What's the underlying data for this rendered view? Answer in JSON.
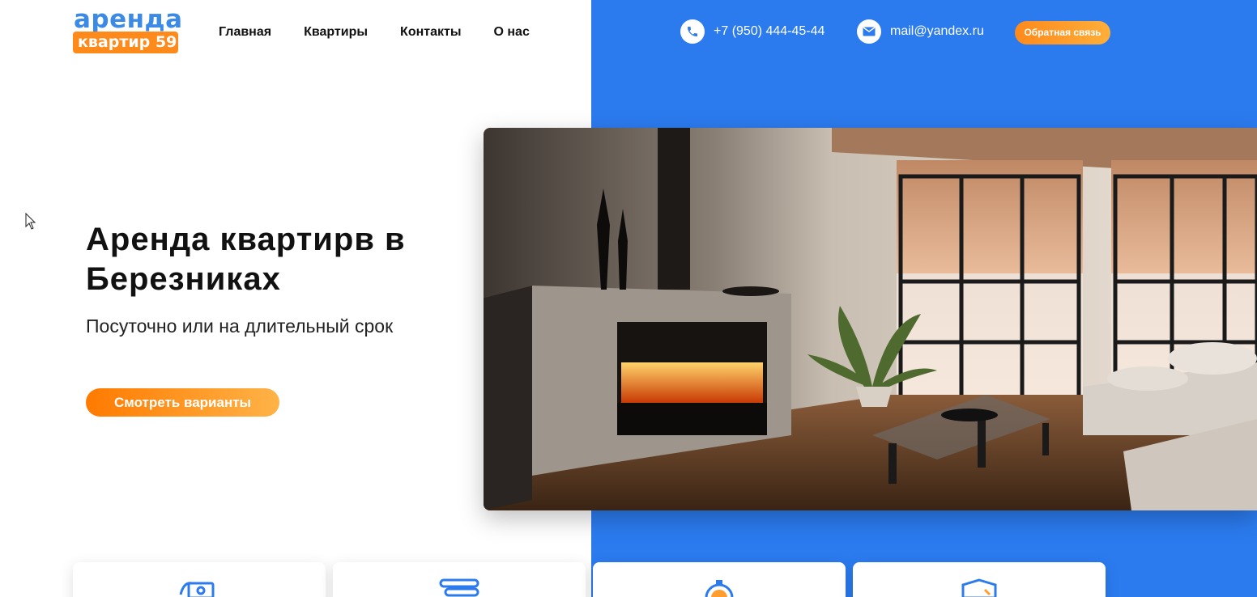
{
  "logo": {
    "line1": "аренда",
    "line2": "квартир 59"
  },
  "nav": [
    "Главная",
    "Квартиры",
    "Контакты",
    "О нас"
  ],
  "header": {
    "phone": "+7 (950) 444-45-44",
    "email": "mail@yandex.ru",
    "callback_label": "Обратная связь"
  },
  "hero": {
    "title": "Аренда квартирв в Березниках",
    "subtitle": "Посуточно или на длительный срок",
    "button_label": "Смотреть варианты"
  },
  "features": [
    {
      "icon": "money-icon"
    },
    {
      "icon": "bills-icon"
    },
    {
      "icon": "stopwatch-icon"
    },
    {
      "icon": "shield-icon"
    }
  ],
  "colors": {
    "brand_blue": "#2b7bef",
    "accent_orange": "#ff8a1c",
    "logo_blue": "#3a8ae6"
  }
}
